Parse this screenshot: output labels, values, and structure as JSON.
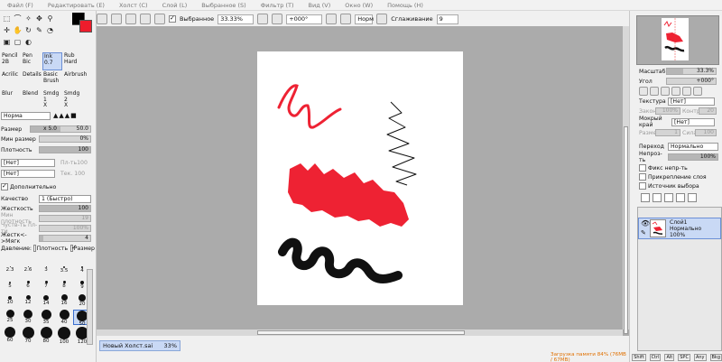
{
  "menu": [
    "Файл (F)",
    "Редактировать (E)",
    "Холст (C)",
    "Слой (L)",
    "Выбранное (S)",
    "Фильтр (T)",
    "Вид (V)",
    "Окно (W)",
    "Помощь (H)"
  ],
  "toolbar": {
    "selection_label": "Выбранное",
    "zoom": "33.33%",
    "angle": "+000°",
    "mode": "Норм",
    "smoothing_label": "Сглаживание",
    "smoothing_value": "9"
  },
  "brushes": [
    {
      "name": "Pencil",
      "size": "2B"
    },
    {
      "name": "Pen",
      "size": "Bic"
    },
    {
      "name": "Ink",
      "size": "0.7"
    },
    {
      "name": "Rub",
      "size": "Hard"
    },
    {
      "name": "Acrilic",
      "size": ""
    },
    {
      "name": "Details",
      "size": ""
    },
    {
      "name": "Basic",
      "size": "Brush"
    },
    {
      "name": "Airbrush",
      "size": ""
    },
    {
      "name": "Blur",
      "size": ""
    },
    {
      "name": "Blend",
      "size": ""
    },
    {
      "name": "Smdg 1",
      "size": "X"
    },
    {
      "name": "Smdg 2",
      "size": "X"
    }
  ],
  "brush_settings": {
    "mode": "Норма",
    "size_label": "Размер",
    "size_mult": "x 5.0",
    "size_value": "50.0",
    "min_size_label": "Мин размер",
    "min_size_value": "0%",
    "density_label": "Плотность",
    "density_value": "100",
    "texture_none": "[Нет]",
    "texture_field": "Пл-ть100",
    "edge_none": "[Нет]",
    "edge_field": "Тек. 100",
    "advanced_label": "Дополнительно",
    "quality_label": "Качество",
    "quality_value": "1 (Быстро)",
    "hardness_label": "Жесткость",
    "hardness_value": "100",
    "min_density_label": "Мин плотность",
    "min_density_value": "19",
    "pressure_sens_label": "Чуств-ть пл-ти",
    "pressure_sens_value": "100%",
    "pressure_hard_label": "Жестк<->Мягк",
    "pressure_hard_value": "4",
    "pressure_label": "Давление:",
    "pressure_density": "Плотность",
    "pressure_size": "Размер"
  },
  "dot_sizes": [
    "2.3",
    "2.6",
    "3",
    "3.5",
    "4",
    "5",
    "6",
    "7",
    "8",
    "9",
    "10",
    "12",
    "14",
    "16",
    "20",
    "25",
    "30",
    "35",
    "40",
    "50",
    "60",
    "70",
    "80",
    "100",
    "120"
  ],
  "document": {
    "name": "Новый Холст.sai",
    "zoom": "33%"
  },
  "navigator": {
    "scale_label": "Масштаб",
    "scale_value": "33.3%",
    "angle_label": "Угол",
    "angle_value": "+000°"
  },
  "layer_props": {
    "texture_label": "Текстура",
    "texture_value": "[Нет]",
    "texture_scale": "Закон",
    "texture_scale_value": "100%",
    "texture_contrast": "Контр",
    "texture_contrast_value": "20",
    "wet_label": "Мокрый край",
    "wet_value": "[Нет]",
    "wet_size": "Размер",
    "wet_size_value": "1",
    "wet_strength": "Сила",
    "wet_strength_value": "100",
    "blend_label": "Переход",
    "blend_value": "Нормально",
    "opacity_label": "Непроз-ть",
    "opacity_value": "100%",
    "fix_opacity": "Фикс непр-ть",
    "clip_layer": "Прикрепление слоя",
    "selection_source": "Источник выбора"
  },
  "layer": {
    "name": "Слой1",
    "mode": "Нормально",
    "opacity": "100%"
  },
  "status": {
    "memory": "Загрузка памяти 84% (76MB / 67MB)",
    "buttons": [
      "Shift",
      "Ctrl",
      "Alt",
      "SPC",
      "Any",
      "Bkg"
    ]
  },
  "colors": {
    "primary": "#000000",
    "secondary": "#ee1c2c",
    "stroke_red": "#ee2233",
    "stroke_black": "#111111"
  }
}
